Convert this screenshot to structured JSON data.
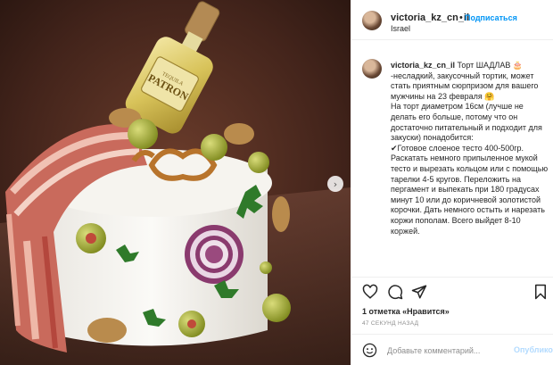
{
  "post": {
    "username": "victoria_kz_cn_il",
    "dot": "•",
    "follow_label": "Подписаться",
    "location": "Israel",
    "caption": " Торт ШАДЛАВ 🎂 -несладкий, закусочный тортик, может стать приятным сюрпризом для вашего мужчины на 23 февраля 🤗\nНа торт диаметром 16см (лучше не делать его больше, потому что он достаточно питательный и подходит для закуски) понадобится:\n✔Готовое слоеное тесто 400-500гр. Раскатать немного припыленное мукой тесто и вырезать кольцом или с помощью тарелки 4-5 кругов. Переложить на пергамент и выпекать при 180 градусах минут 10 или до коричневой золотистой корочки. Дать немного остыть и нарезать коржи пополам. Всего выйдет 8-10 коржей.",
    "likes_label": "1 отметка «Нравится»",
    "time_ago": "47 СЕКУНД НАЗАД",
    "comment_placeholder": "Добавьте комментарий...",
    "publish_label": "Опубликовать"
  },
  "photo": {
    "bottle_brand": "PATRON",
    "bottle_subtext": "TEQUILA"
  },
  "colors": {
    "link": "#0095f6",
    "publish_disabled": "#b3dbff",
    "muted": "#8e8e8e"
  }
}
